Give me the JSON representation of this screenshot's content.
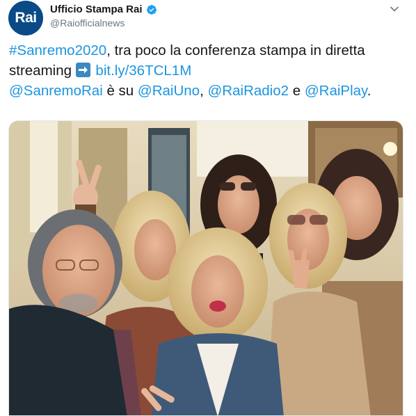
{
  "account": {
    "avatar_text": "Rai",
    "display_name": "Ufficio Stampa Rai",
    "handle": "@Raiofficialnews",
    "verified": true
  },
  "tweet": {
    "hashtag_1": "#Sanremo2020",
    "text_1": ", tra poco la conferenza stampa in diretta streaming ",
    "link": "bit.ly/36TCL1M",
    "mention_1": "@SanremoRai",
    "text_2": " è su ",
    "mention_2": "@RaiUno",
    "sep_1": ", ",
    "mention_3": "@RaiRadio2",
    "sep_2": " e ",
    "mention_4": "@RaiPlay",
    "end": "."
  },
  "media": {
    "kind": "photo"
  },
  "colors": {
    "link": "#1b95e0",
    "avatar_bg": "#0a4a86",
    "verified": "#1da1f2",
    "text": "#14171a",
    "handle": "#657786"
  },
  "icons": {
    "verified": "verified-badge-icon",
    "caret": "chevron-down-icon",
    "arrow": "right-arrow-emoji-icon"
  }
}
